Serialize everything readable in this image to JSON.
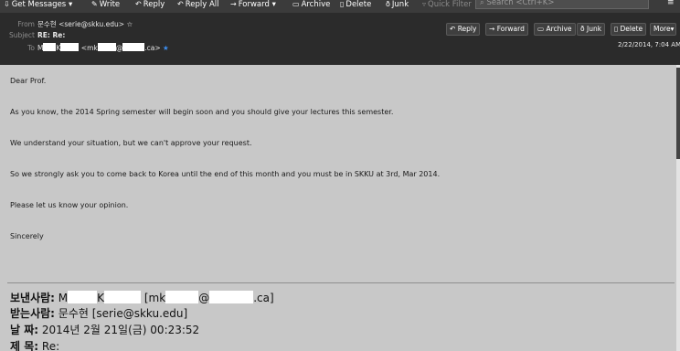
{
  "toolbar": {
    "get_messages": "Get Messages",
    "write": "Write",
    "reply": "Reply",
    "reply_all": "Reply All",
    "forward": "Forward",
    "archive": "Archive",
    "delete": "Delete",
    "junk": "Junk",
    "quick_filter": "Quick Filter",
    "search_placeholder": "Search <Ctrl+K>"
  },
  "header": {
    "from_label": "From",
    "from_value": "문수현 <serie@skku.edu>",
    "subject_label": "Subject",
    "subject_value": "RE: Re:",
    "to_label": "To",
    "to_parts": [
      "M",
      "K",
      "<mk",
      "@",
      ".ca>"
    ],
    "date": "2/22/2014, 7:04 AM",
    "buttons": {
      "reply": "Reply",
      "forward": "Forward",
      "archive": "Archive",
      "junk": "Junk",
      "delete": "Delete",
      "more": "More"
    }
  },
  "message": {
    "paragraphs": [
      "Dear Prof.",
      "As you know, the 2014 Spring semester will begin soon and you should give your lectures this semester.",
      "We understand your situation, but we can't approve your request.",
      "So we strongly ask you to come back to Korea until the end of this month and you must be in SKKU at 3rd, Mar 2014.",
      "Please let us know your opinion.",
      "Sincerely"
    ],
    "quoted": {
      "sender_label": "보낸사람:",
      "sender_parts": [
        "M",
        "K",
        "[mk",
        "@",
        ".ca]"
      ],
      "recipient_label": "받는사람:",
      "recipient_value": "문수현 [serie@skku.edu]",
      "date_label": "날 짜:",
      "date_value": "2014년 2월 21일(금) 00:23:52",
      "subject_label": "제 목:",
      "subject_value": "Re:"
    }
  },
  "colors": {
    "toolbar_bg": "#3b3b3b",
    "header_bg": "#2b2b2b",
    "body_bg": "#c8c8c8",
    "accent_star": "#3d8ef0"
  }
}
